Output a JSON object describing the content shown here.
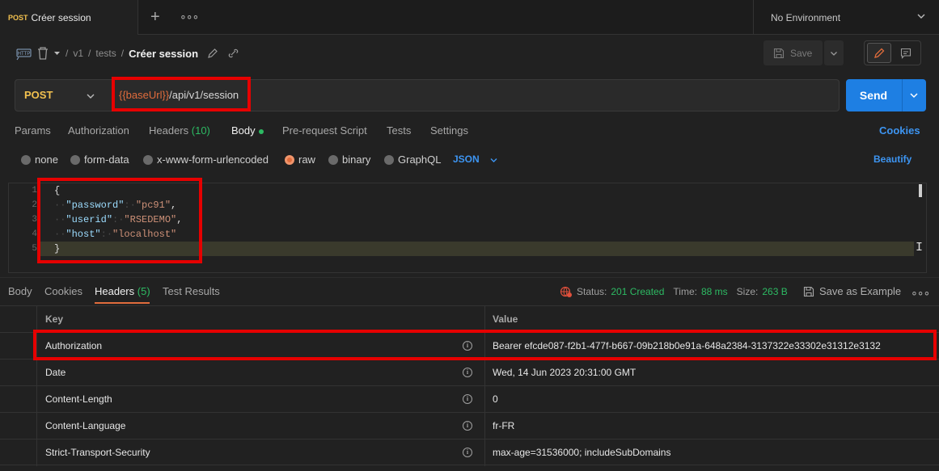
{
  "tabbar": {
    "tab_method": "POST",
    "tab_title": "Créer session",
    "environment": "No Environment"
  },
  "breadcrumb": {
    "seg1": "v1",
    "seg2": "tests",
    "current": "Créer session",
    "sep": "/"
  },
  "toolbar": {
    "save_label": "Save"
  },
  "request": {
    "method": "POST",
    "url_var": "{{baseUrl}}",
    "url_path": "/api/v1/session",
    "send_label": "Send"
  },
  "request_tabs": {
    "params": "Params",
    "authorization": "Authorization",
    "headers": "Headers",
    "headers_count": "(10)",
    "body": "Body",
    "pre_request": "Pre-request Script",
    "tests": "Tests",
    "settings": "Settings",
    "cookies": "Cookies"
  },
  "body_options": {
    "none": "none",
    "form_data": "form-data",
    "urlencoded": "x-www-form-urlencoded",
    "raw": "raw",
    "binary": "binary",
    "graphql": "GraphQL",
    "format": "JSON",
    "beautify": "Beautify"
  },
  "editor": {
    "line_numbers": [
      "1",
      "2",
      "3",
      "4",
      "5"
    ],
    "open_brace": "{",
    "close_brace": "}",
    "indent": "··",
    "colon": ":·",
    "comma": ",",
    "lines": [
      {
        "key": "\"password\"",
        "value": "\"pc91\""
      },
      {
        "key": "\"userid\"",
        "value": "\"RSEDEMO\""
      },
      {
        "key": "\"host\"",
        "value": "\"localhost\""
      }
    ]
  },
  "response_tabs": {
    "body": "Body",
    "cookies": "Cookies",
    "headers": "Headers",
    "headers_count": "(5)",
    "test_results": "Test Results"
  },
  "response_status": {
    "status_label": "Status:",
    "status_value": "201 Created",
    "time_label": "Time:",
    "time_value": "88 ms",
    "size_label": "Size:",
    "size_value": "263 B",
    "save_example": "Save as Example"
  },
  "headers_table": {
    "columns": [
      "Key",
      "Value"
    ],
    "info_glyph": "i",
    "rows": [
      {
        "key": "Authorization",
        "value": "Bearer efcde087-f2b1-477f-b667-09b218b0e91a-648a2384-3137322e33302e31312e3132"
      },
      {
        "key": "Date",
        "value": "Wed, 14 Jun 2023 20:31:00 GMT"
      },
      {
        "key": "Content-Length",
        "value": "0"
      },
      {
        "key": "Content-Language",
        "value": "fr-FR"
      },
      {
        "key": "Strict-Transport-Security",
        "value": "max-age=31536000; includeSubDomains"
      }
    ]
  },
  "colors": {
    "accent_orange": "#e06c3c",
    "send_blue": "#1e7fe3",
    "link_blue": "#3d95f2",
    "success_green": "#2dba63",
    "method_yellow": "#f2c14f",
    "highlight_red": "#e60000"
  },
  "icons": [
    "http-icon",
    "trash-icon",
    "pencil-icon",
    "link-icon",
    "floppy-icon",
    "chevron-down-icon",
    "comment-icon",
    "globe-error-icon",
    "more-icon",
    "plus-icon",
    "close-icon",
    "info-icon"
  ]
}
